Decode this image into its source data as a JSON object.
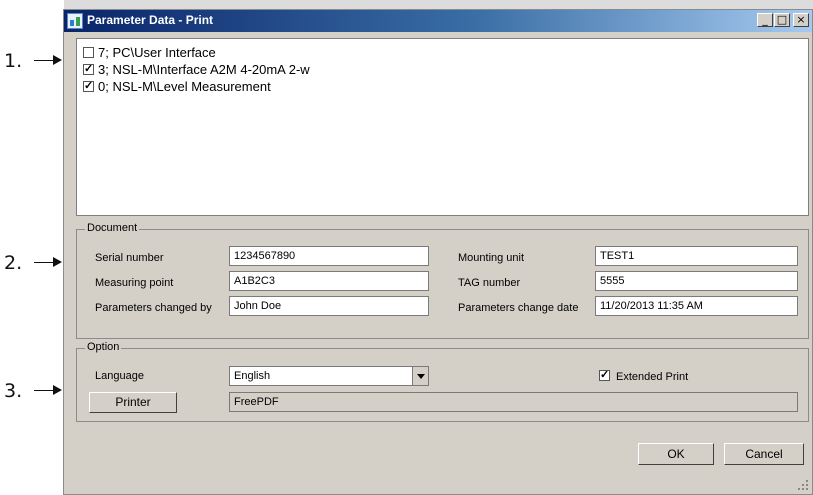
{
  "window": {
    "title": "Parameter Data - Print",
    "minimize_glyph": "_",
    "maximize_glyph": "□",
    "close_glyph": "×"
  },
  "callouts": [
    "1.",
    "2.",
    "3."
  ],
  "list": {
    "items": [
      {
        "label": "7; PC\\User Interface",
        "checked": false
      },
      {
        "label": "3; NSL-M\\Interface A2M 4-20mA 2-w",
        "checked": true
      },
      {
        "label": "0; NSL-M\\Level Measurement",
        "checked": true
      }
    ]
  },
  "document": {
    "title": "Document",
    "serial_label": "Serial number",
    "serial_value": "1234567890",
    "measuring_label": "Measuring point",
    "measuring_value": "A1B2C3",
    "changed_by_label": "Parameters changed by",
    "changed_by_value": "John Doe",
    "mounting_label": "Mounting unit",
    "mounting_value": "TEST1",
    "tag_label": "TAG number",
    "tag_value": "5555",
    "change_date_label": "Parameters change date",
    "change_date_value": "11/20/2013 11:35 AM"
  },
  "option": {
    "title": "Option",
    "language_label": "Language",
    "language_value": "English",
    "extended_print_label": "Extended Print",
    "extended_print_checked": true,
    "printer_button": "Printer",
    "printer_value": "FreePDF"
  },
  "footer": {
    "ok_label": "OK",
    "cancel_label": "Cancel"
  }
}
